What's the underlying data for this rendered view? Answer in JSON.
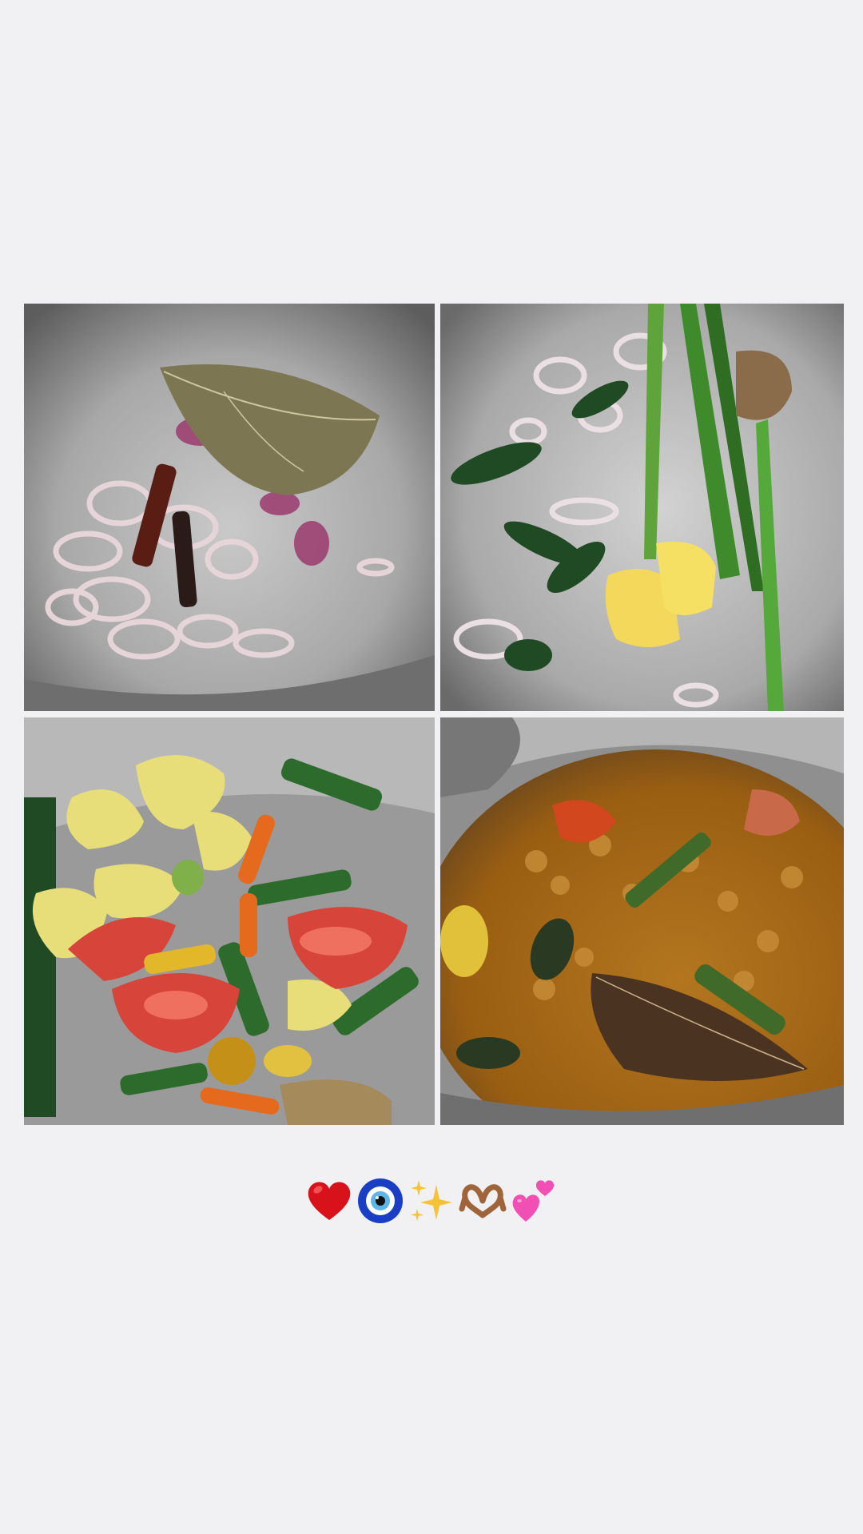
{
  "caption": {
    "emojis": [
      "red-heart-icon",
      "nazar-amulet-icon",
      "sparkles-icon",
      "heart-hands-icon",
      "two-hearts-icon"
    ]
  },
  "photos": [
    {
      "name": "photo-shallots-bay-leaf"
    },
    {
      "name": "photo-pandan-curry-leaves-ginger"
    },
    {
      "name": "photo-potatoes-tomatoes-chillies"
    },
    {
      "name": "photo-finished-curry"
    }
  ],
  "colors": {
    "background": "#f1f1f3",
    "heart": "#d8121b",
    "nazar_blue": "#1a3fc4",
    "sparkle": "#f6c23a",
    "heart_hands": "#a0643a",
    "pink_hearts": "#f24fb4"
  }
}
